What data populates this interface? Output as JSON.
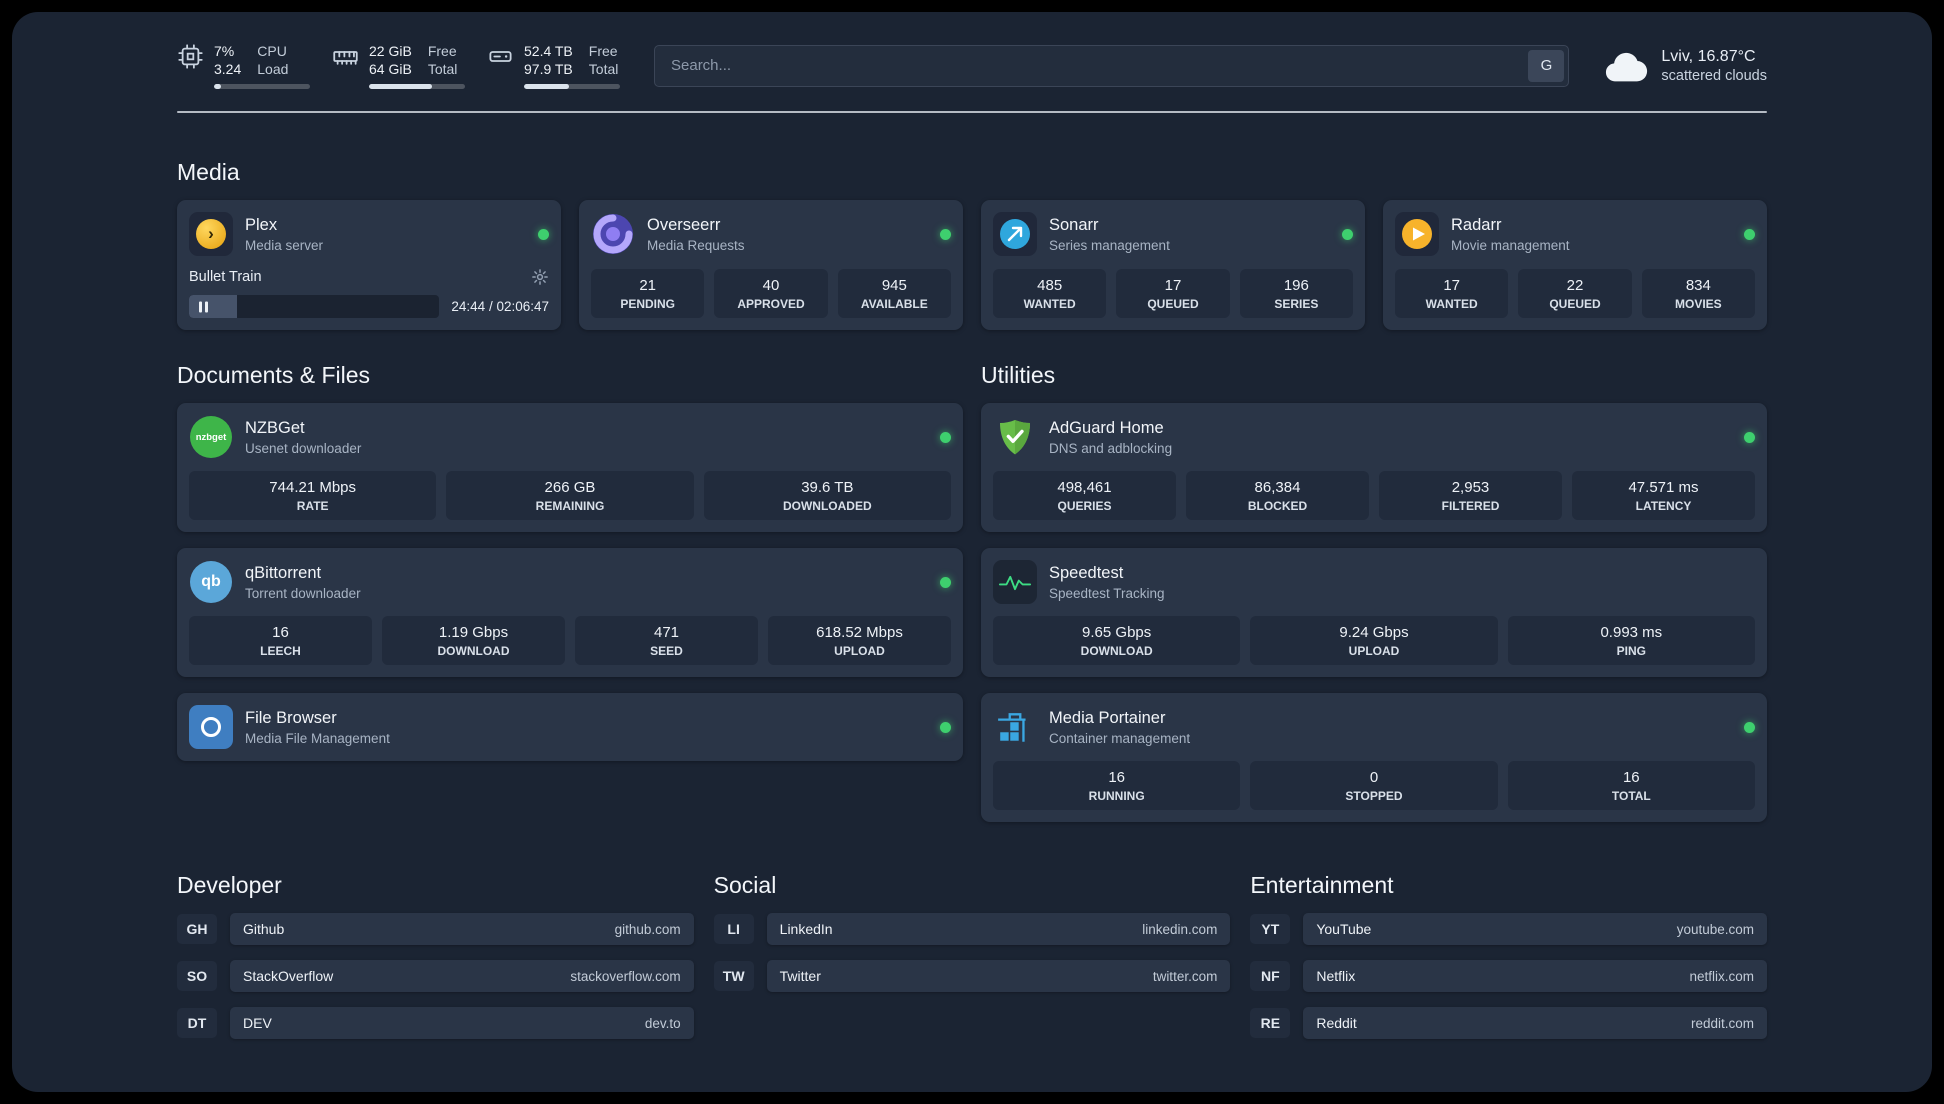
{
  "colors": {
    "status_online": "#3ecf6e",
    "plex_amber": "#e5a00d",
    "overseerr_purple": "#4c46b0",
    "sonarr_blue": "#2fa7dd",
    "radarr_gold": "#f7b32b",
    "nzbget_green": "#3eb549",
    "qbittorrent_blue": "#5ba7d9",
    "filebrowser_blue": "#3f7ec1",
    "adguard_green": "#68bd49",
    "speedtest_green": "#3ddc84",
    "portainer_blue": "#3aa7e2"
  },
  "topbar": {
    "cpu": {
      "value_top": "7%",
      "value_bottom": "3.24",
      "label_top": "CPU",
      "label_bottom": "Load",
      "bar_percent": 7
    },
    "memory": {
      "value_top": "22 GiB",
      "value_bottom": "64 GiB",
      "label_top": "Free",
      "label_bottom": "Total",
      "bar_percent": 66
    },
    "disk": {
      "value_top": "52.4 TB",
      "value_bottom": "97.9 TB",
      "label_top": "Free",
      "label_bottom": "Total",
      "bar_percent": 47
    },
    "search": {
      "placeholder": "Search...",
      "engine_button": "G"
    },
    "weather": {
      "location": "Lviv, 16.87°C",
      "condition": "scattered clouds"
    }
  },
  "media": {
    "title": "Media",
    "plex": {
      "name": "Plex",
      "subtitle": "Media server",
      "now_playing": "Bullet Train",
      "time": "24:44 / 02:06:47",
      "progress_percent": 19
    },
    "overseerr": {
      "name": "Overseerr",
      "subtitle": "Media Requests",
      "stats": [
        {
          "value": "21",
          "label": "PENDING"
        },
        {
          "value": "40",
          "label": "APPROVED"
        },
        {
          "value": "945",
          "label": "AVAILABLE"
        }
      ]
    },
    "sonarr": {
      "name": "Sonarr",
      "subtitle": "Series management",
      "stats": [
        {
          "value": "485",
          "label": "WANTED"
        },
        {
          "value": "17",
          "label": "QUEUED"
        },
        {
          "value": "196",
          "label": "SERIES"
        }
      ]
    },
    "radarr": {
      "name": "Radarr",
      "subtitle": "Movie management",
      "stats": [
        {
          "value": "17",
          "label": "WANTED"
        },
        {
          "value": "22",
          "label": "QUEUED"
        },
        {
          "value": "834",
          "label": "MOVIES"
        }
      ]
    }
  },
  "documents": {
    "title": "Documents & Files",
    "nzbget": {
      "name": "NZBGet",
      "subtitle": "Usenet downloader",
      "stats": [
        {
          "value": "744.21 Mbps",
          "label": "RATE"
        },
        {
          "value": "266 GB",
          "label": "REMAINING"
        },
        {
          "value": "39.6 TB",
          "label": "DOWNLOADED"
        }
      ]
    },
    "qbittorrent": {
      "name": "qBittorrent",
      "subtitle": "Torrent downloader",
      "stats": [
        {
          "value": "16",
          "label": "LEECH"
        },
        {
          "value": "1.19 Gbps",
          "label": "DOWNLOAD"
        },
        {
          "value": "471",
          "label": "SEED"
        },
        {
          "value": "618.52 Mbps",
          "label": "UPLOAD"
        }
      ]
    },
    "filebrowser": {
      "name": "File Browser",
      "subtitle": "Media File Management"
    }
  },
  "utilities": {
    "title": "Utilities",
    "adguard": {
      "name": "AdGuard Home",
      "subtitle": "DNS and adblocking",
      "stats": [
        {
          "value": "498,461",
          "label": "QUERIES"
        },
        {
          "value": "86,384",
          "label": "BLOCKED"
        },
        {
          "value": "2,953",
          "label": "FILTERED"
        },
        {
          "value": "47.571 ms",
          "label": "LATENCY"
        }
      ]
    },
    "speedtest": {
      "name": "Speedtest",
      "subtitle": "Speedtest Tracking",
      "stats": [
        {
          "value": "9.65 Gbps",
          "label": "DOWNLOAD"
        },
        {
          "value": "9.24 Gbps",
          "label": "UPLOAD"
        },
        {
          "value": "0.993 ms",
          "label": "PING"
        }
      ]
    },
    "portainer": {
      "name": "Media Portainer",
      "subtitle": "Container management",
      "stats": [
        {
          "value": "16",
          "label": "RUNNING"
        },
        {
          "value": "0",
          "label": "STOPPED"
        },
        {
          "value": "16",
          "label": "TOTAL"
        }
      ]
    }
  },
  "bookmarks": {
    "developer": {
      "title": "Developer",
      "links": [
        {
          "abbr": "GH",
          "name": "Github",
          "url": "github.com"
        },
        {
          "abbr": "SO",
          "name": "StackOverflow",
          "url": "stackoverflow.com"
        },
        {
          "abbr": "DT",
          "name": "DEV",
          "url": "dev.to"
        }
      ]
    },
    "social": {
      "title": "Social",
      "links": [
        {
          "abbr": "LI",
          "name": "LinkedIn",
          "url": "linkedin.com"
        },
        {
          "abbr": "TW",
          "name": "Twitter",
          "url": "twitter.com"
        }
      ]
    },
    "entertainment": {
      "title": "Entertainment",
      "links": [
        {
          "abbr": "YT",
          "name": "YouTube",
          "url": "youtube.com"
        },
        {
          "abbr": "NF",
          "name": "Netflix",
          "url": "netflix.com"
        },
        {
          "abbr": "RE",
          "name": "Reddit",
          "url": "reddit.com"
        }
      ]
    }
  },
  "icons": {
    "plex_glyph": "›",
    "nzbget_text": "nzbget",
    "qbittorrent_text": "qb"
  }
}
